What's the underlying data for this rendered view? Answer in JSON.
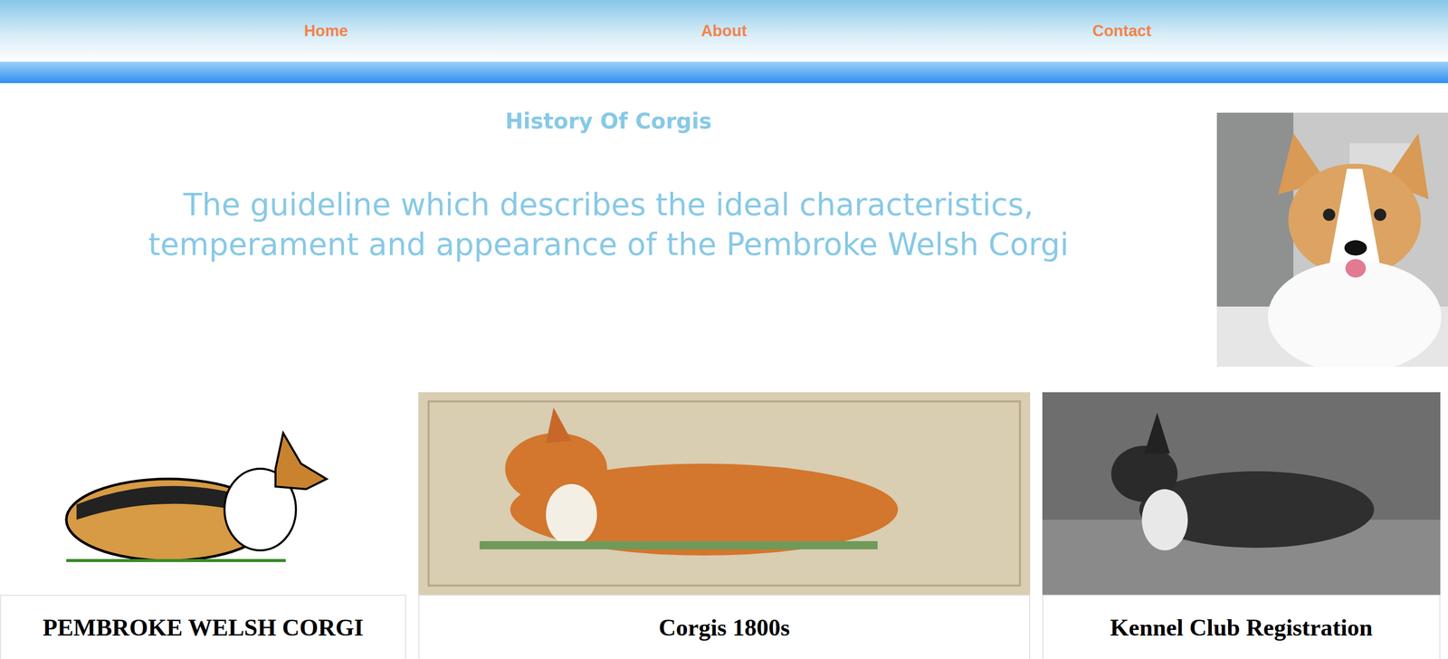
{
  "nav": {
    "links": [
      "Home",
      "About",
      "Contact"
    ]
  },
  "hero": {
    "heading": "History Of Corgis",
    "subheading": "The guideline which describes the ideal characteristics, temperament and appearance of the Pembroke Welsh Corgi"
  },
  "cards": [
    {
      "title": "PEMBROKE WELSH CORGI",
      "kind": "drawing"
    },
    {
      "title": "Corgis 1800s",
      "kind": "painting"
    },
    {
      "title": "Kennel Club Registration",
      "kind": "photo"
    }
  ]
}
